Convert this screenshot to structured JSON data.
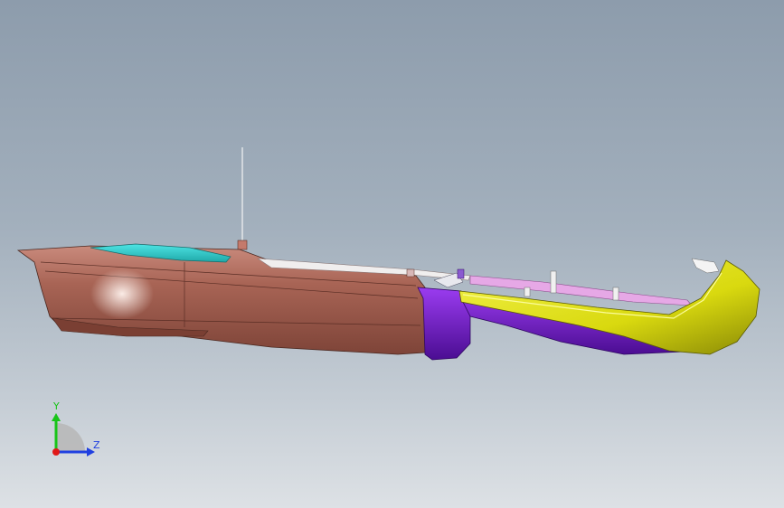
{
  "viewport": {
    "background": {
      "top": "#8d9cac",
      "bottom": "#dde1e5"
    }
  },
  "model": {
    "parts": [
      {
        "name": "rear-housing",
        "color": "#a86455"
      },
      {
        "name": "top-cover",
        "color": "#2fc9c9"
      },
      {
        "name": "purple-joint-block",
        "color": "#7a14d9"
      },
      {
        "name": "front-yellow-shell",
        "color": "#d9d90f"
      },
      {
        "name": "front-purple-shell",
        "color": "#5a14a8"
      },
      {
        "name": "pink-inner-panel",
        "color": "#e6a8e6"
      }
    ]
  },
  "triad": {
    "y_label": "Y",
    "z_label": "Z",
    "y_color": "#18c418",
    "z_color": "#2040e0",
    "x_color": "#e01818"
  }
}
